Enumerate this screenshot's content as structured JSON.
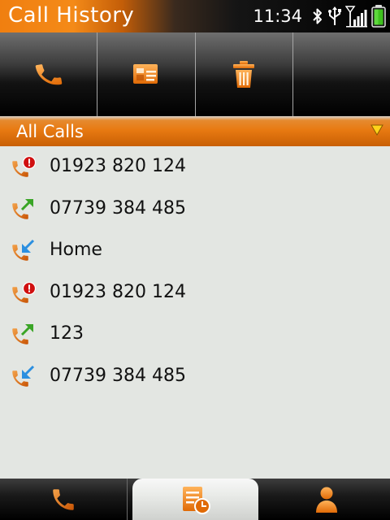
{
  "title_bar": {
    "title": "Call History"
  },
  "status_bar": {
    "time": "11:34",
    "icons": [
      "bluetooth-icon",
      "usb-icon",
      "signal-icon",
      "battery-icon"
    ]
  },
  "toolbar": {
    "buttons": [
      {
        "icon": "phone-icon"
      },
      {
        "icon": "contact-card-icon"
      },
      {
        "icon": "trash-icon"
      },
      {
        "icon": ""
      }
    ]
  },
  "filter": {
    "selected": "All Calls"
  },
  "calls": [
    {
      "type": "missed",
      "number": "01923 820 124"
    },
    {
      "type": "outgoing",
      "number": "07739 384 485"
    },
    {
      "type": "incoming",
      "number": "Home"
    },
    {
      "type": "missed",
      "number": "01923 820 124"
    },
    {
      "type": "outgoing",
      "number": "123"
    },
    {
      "type": "incoming",
      "number": "07739 384 485"
    }
  ],
  "tabs": [
    {
      "icon": "phone-icon",
      "active": false
    },
    {
      "icon": "call-log-icon",
      "active": true
    },
    {
      "icon": "person-icon",
      "active": false
    }
  ],
  "colors": {
    "accent": "#e87a12",
    "missed": "#d01010",
    "outgoing": "#3aa526",
    "incoming": "#2b8fe0"
  }
}
